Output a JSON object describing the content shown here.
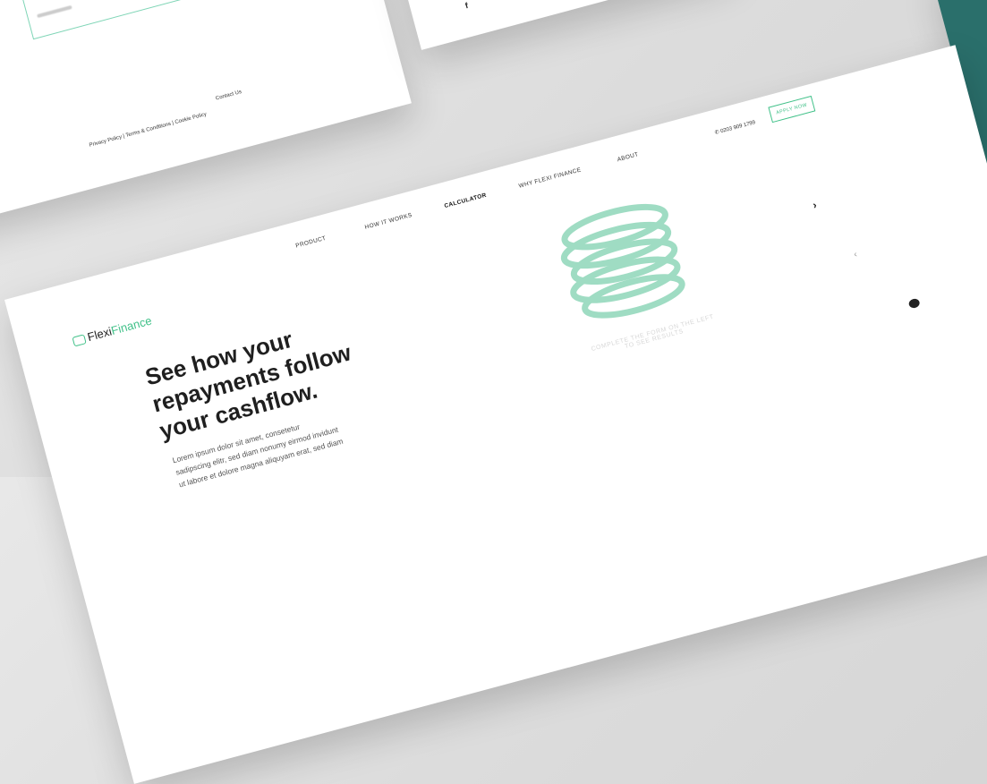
{
  "secondary_pages": {
    "footer": {
      "privacy": "Privacy Policy",
      "separator": "|",
      "terms": "Terms & Conditions",
      "cookie": "Cookie Policy",
      "contact": "Contact Us"
    },
    "social_icon": "f"
  },
  "nav": {
    "items": [
      "PRODUCT",
      "HOW IT WORKS",
      "CALCULATOR",
      "WHY FLEXI FINANCE",
      "ABOUT"
    ],
    "active": "CALCULATOR",
    "phone": "0203 909 1799",
    "apply_label": "APPLY NOW"
  },
  "brand": {
    "name_part1": "Flexi",
    "name_part2": "Finance",
    "accent_color": "#41c189",
    "teal_color": "#2a6f6b"
  },
  "hero": {
    "headline_lines": [
      "See how your",
      "repayments follow",
      "your cashflow."
    ],
    "body_lines": [
      "Lorem ipsum dolor sit amet, consetetur",
      "sadipscing elitr, sed diam nonumy eirmod invidunt",
      "ut labore et dolore magna aliquyam erat, sed diam"
    ]
  },
  "results": {
    "hint_line1": "COMPLETE THE FORM ON THE LEFT",
    "hint_line2": "TO SEE RESULTS"
  },
  "controls": {
    "next_arrow": "›",
    "prev_arrow": "‹"
  }
}
